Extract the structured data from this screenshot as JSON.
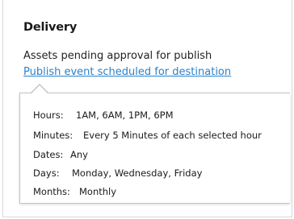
{
  "delivery": {
    "title": "Delivery",
    "status": "Assets pending approval for publish",
    "link": "Publish event scheduled for destination"
  },
  "schedule": {
    "rows": [
      {
        "label": "Hours:",
        "value": "1AM, 6AM, 1PM, 6PM"
      },
      {
        "label": "Minutes:",
        "value": "Every 5 Minutes of each selected hour"
      },
      {
        "label": "Dates:",
        "value": "Any"
      },
      {
        "label": "Days:",
        "value": "Monday, Wednesday, Friday"
      },
      {
        "label": "Months:",
        "value": "Monthly"
      }
    ]
  },
  "colors": {
    "link": "#2a82c9",
    "text": "#1a1a1a",
    "border": "#c4c4c4"
  }
}
